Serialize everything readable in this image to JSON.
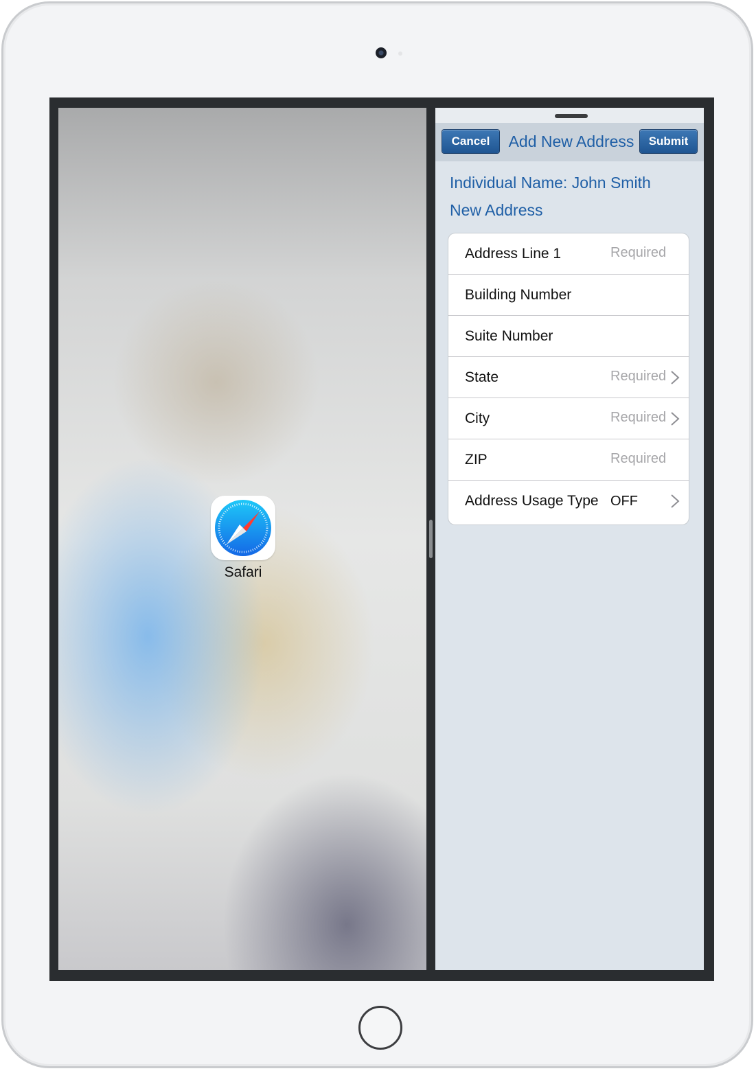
{
  "launcher": {
    "app_name": "Safari"
  },
  "nav": {
    "cancel_label": "Cancel",
    "title": "Add New Address",
    "submit_label": "Submit"
  },
  "header": {
    "individual_name": "Individual Name: John Smith",
    "section_title": "New Address"
  },
  "form": {
    "rows": [
      {
        "label": "Address Line 1",
        "value": "Required"
      },
      {
        "label": "Building Number",
        "value": ""
      },
      {
        "label": "Suite Number",
        "value": ""
      },
      {
        "label": "State",
        "value": "Required"
      },
      {
        "label": "City",
        "value": "Required"
      },
      {
        "label": "ZIP",
        "value": "Required"
      },
      {
        "label": "Address Usage Type",
        "value": "OFF"
      }
    ]
  },
  "colors": {
    "accent": "#1f5fa6",
    "button": "#2a63a3",
    "pane_background": "#dde4eb"
  },
  "icons": [
    "safari-compass-icon",
    "chevron-right-icon",
    "camera-icon",
    "home-button"
  ]
}
